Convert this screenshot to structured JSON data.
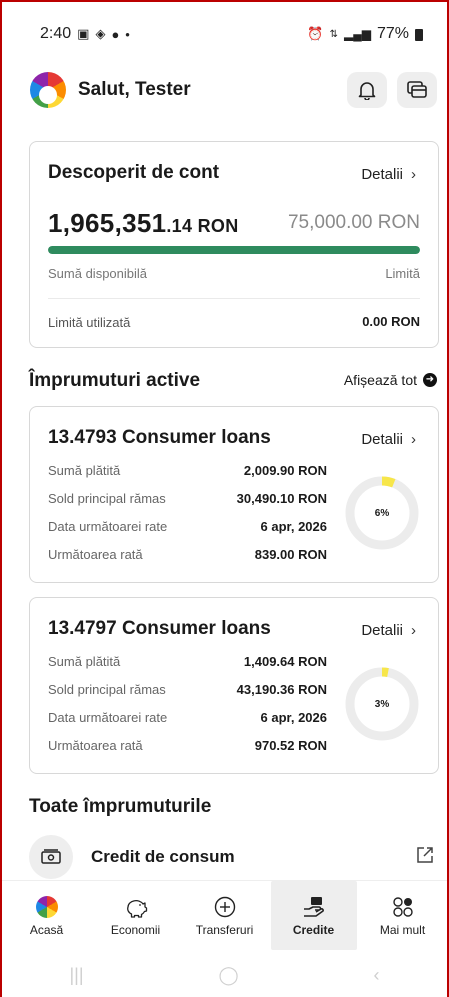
{
  "status": {
    "time": "2:40",
    "battery": "77%"
  },
  "header": {
    "greeting": "Salut, Tester"
  },
  "overdraft": {
    "title": "Descoperit de cont",
    "details_label": "Detalii",
    "amount_main": "1,965,351",
    "amount_cents": ".14 RON",
    "limit": "75,000.00 RON",
    "available_label": "Sumă disponibilă",
    "limit_label": "Limită",
    "used_label": "Limită utilizată",
    "used_value": "0.00 RON",
    "progress_fraction": 1.0
  },
  "active_loans": {
    "title": "Împrumuturi active",
    "see_all": "Afișează tot",
    "loans": [
      {
        "title": "13.4793 Consumer loans",
        "details_label": "Detalii",
        "paid_label": "Sumă plătită",
        "paid_value": "2,009.90 RON",
        "principal_label": "Sold principal rămas",
        "principal_value": "30,490.10 RON",
        "next_date_label": "Data următoarei rate",
        "next_date_value": "6 apr, 2026",
        "next_rate_label": "Următoarea rată",
        "next_rate_value": "839.00 RON",
        "progress_percent": 6,
        "progress_text": "6%"
      },
      {
        "title": "13.4797 Consumer loans",
        "details_label": "Detalii",
        "paid_label": "Sumă plătită",
        "paid_value": "1,409.64 RON",
        "principal_label": "Sold principal rămas",
        "principal_value": "43,190.36 RON",
        "next_date_label": "Data următoarei rate",
        "next_date_value": "6 apr, 2026",
        "next_rate_label": "Următoarea rată",
        "next_rate_value": "970.52 RON",
        "progress_percent": 3,
        "progress_text": "3%"
      }
    ]
  },
  "all_loans": {
    "title": "Toate împrumuturile",
    "item_label": "Credit de consum"
  },
  "nav": {
    "home": "Acasă",
    "savings": "Economii",
    "transfers": "Transferuri",
    "credits": "Credite",
    "more": "Mai mult"
  },
  "colors": {
    "progress_green": "#2e8b5e",
    "donut_yellow": "#f7e64a",
    "donut_track": "#ececec"
  }
}
